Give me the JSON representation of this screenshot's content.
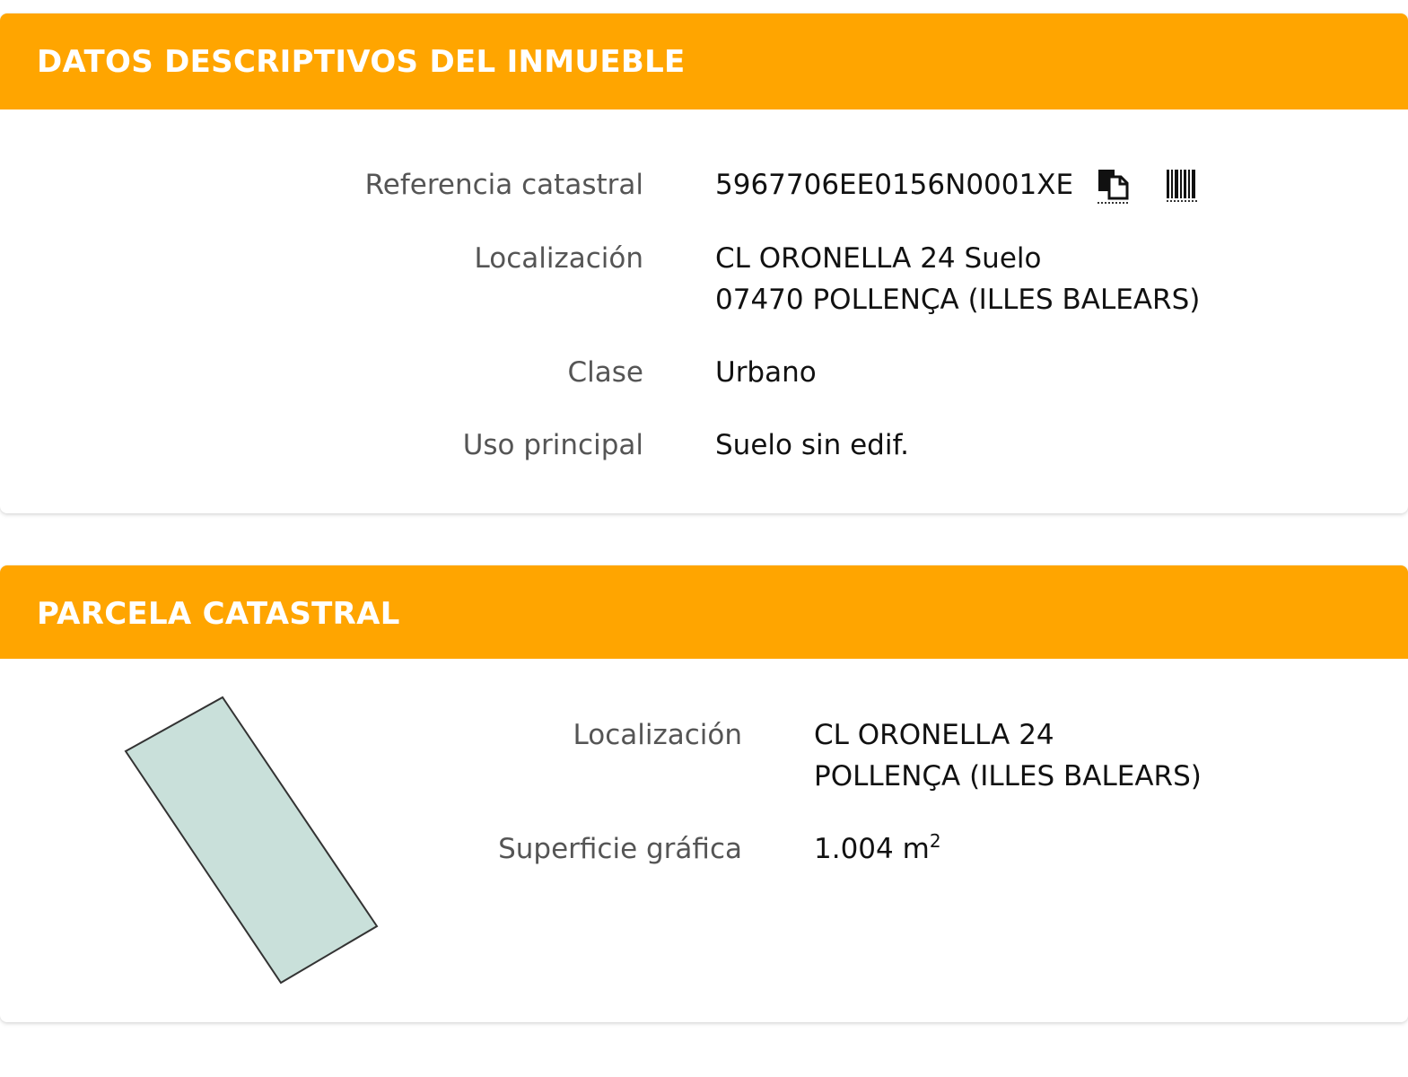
{
  "datos": {
    "title": "DATOS DESCRIPTIVOS DEL INMUEBLE",
    "rows": {
      "referencia": {
        "label": "Referencia catastral",
        "value": "5967706EE0156N0001XE"
      },
      "localizacion": {
        "label": "Localización",
        "line1": "CL ORONELLA 24 Suelo",
        "line2": "07470 POLLENÇA (ILLES BALEARS)"
      },
      "clase": {
        "label": "Clase",
        "value": "Urbano"
      },
      "uso": {
        "label": "Uso principal",
        "value": "Suelo sin edif."
      }
    },
    "icons": {
      "copy": "copy-icon",
      "barcode": "barcode-icon"
    }
  },
  "parcela": {
    "title": "PARCELA CATASTRAL",
    "rows": {
      "localizacion": {
        "label": "Localización",
        "line1": "CL ORONELLA 24",
        "line2": "POLLENÇA (ILLES BALEARS)"
      },
      "superficie": {
        "label": "Superficie gráfica",
        "value": "1.004 m",
        "unit_sup": "2"
      }
    },
    "shape_fill": "#c9e0da",
    "shape_stroke": "#333333"
  },
  "colors": {
    "header_bg": "#ffa500",
    "header_text": "#ffffff",
    "label": "#555555",
    "value": "#111111"
  }
}
